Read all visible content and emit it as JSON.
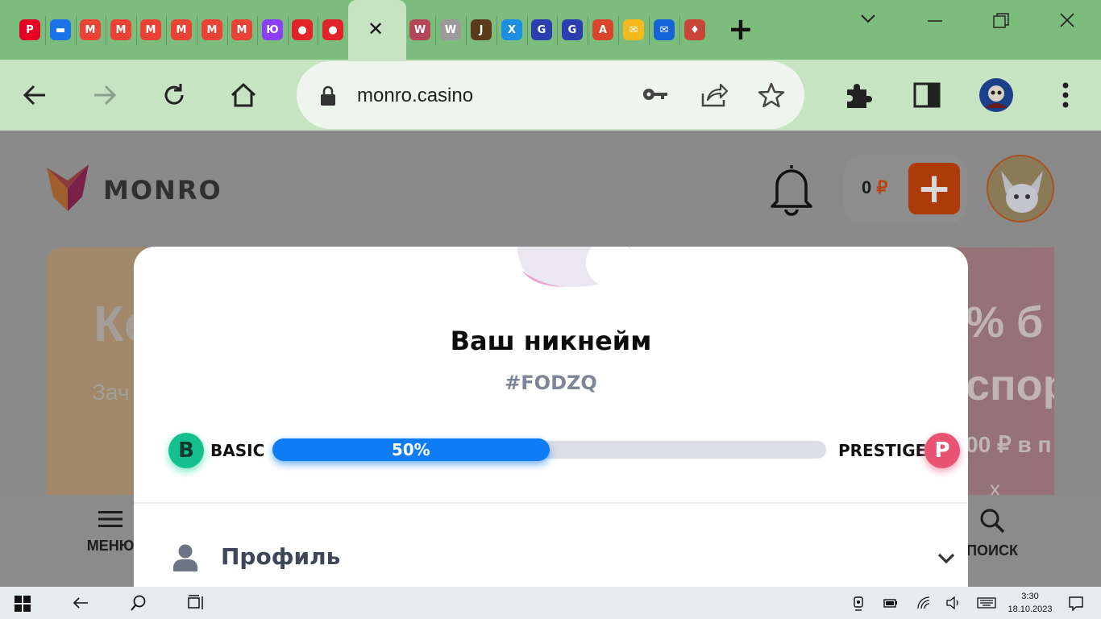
{
  "browser": {
    "tabs": [
      {
        "icon": "pinterest-red-icon",
        "color": "#e60023",
        "glyph": "P"
      },
      {
        "icon": "messages-icon",
        "color": "#1a73e8",
        "glyph": "▬"
      },
      {
        "icon": "gmail-icon",
        "color": "#ea4335",
        "glyph": "M"
      },
      {
        "icon": "gmail-icon",
        "color": "#ea4335",
        "glyph": "M"
      },
      {
        "icon": "gmail-icon",
        "color": "#ea4335",
        "glyph": "M"
      },
      {
        "icon": "gmail-icon",
        "color": "#ea4335",
        "glyph": "M"
      },
      {
        "icon": "gmail-icon",
        "color": "#ea4335",
        "glyph": "M"
      },
      {
        "icon": "gmail-icon",
        "color": "#ea4335",
        "glyph": "M"
      },
      {
        "icon": "yoomoney-icon",
        "color": "#8b3ffd",
        "glyph": "Ю"
      },
      {
        "icon": "casino-chip-icon",
        "color": "#e2232a",
        "glyph": "●"
      },
      {
        "icon": "casino-chip-icon",
        "color": "#e2232a",
        "glyph": "●"
      },
      {
        "icon": "w-logo-icon",
        "color": "#b5465a",
        "glyph": "W"
      },
      {
        "icon": "w-logo-icon",
        "color": "#9b9b9b",
        "glyph": "W"
      },
      {
        "icon": "joker-icon",
        "color": "#5b3a1a",
        "glyph": "J"
      },
      {
        "icon": "x-app-icon",
        "color": "#1d8fe1",
        "glyph": "X"
      },
      {
        "icon": "game-app-icon",
        "color": "#2b3eb0",
        "glyph": "G"
      },
      {
        "icon": "game-app-icon",
        "color": "#2b3eb0",
        "glyph": "G"
      },
      {
        "icon": "translate-icon",
        "color": "#d9442b",
        "glyph": "A"
      },
      {
        "icon": "mail-icon",
        "color": "#f6b91c",
        "glyph": "✉"
      },
      {
        "icon": "mail-icon",
        "color": "#1464d8",
        "glyph": "✉"
      },
      {
        "icon": "cards-icon",
        "color": "#c9453a",
        "glyph": "♦"
      }
    ],
    "active_tab_close": "✕",
    "new_tab": "+",
    "url": "monro.casino"
  },
  "site": {
    "logo_text": "MONRO",
    "balance_amount": "0",
    "balance_currency": "₽",
    "deposit_plus": "+",
    "colors": {
      "accent": "#ad3a08"
    }
  },
  "banner": {
    "left_title": "Ке",
    "left_sub": "Зач",
    "right_line1": "% б",
    "right_line2": "спор",
    "right_line3": "00 ₽ в п",
    "right_line4": "х ставок"
  },
  "bottom_nav": {
    "menu_label": "МЕНЮ",
    "search_label": "ПОИСК"
  },
  "modal": {
    "nickname": "Ваш никнейм",
    "tag": "#FODZQ",
    "level_current_letter": "B",
    "level_current": "BASIC",
    "progress_text": "50%",
    "progress": 0.5,
    "level_next": "PRESTIGE",
    "level_next_letter": "P",
    "colors": {
      "basic": "#16c08e",
      "prestige": "#ea5474",
      "progress": "#0d7cf5"
    },
    "profile_label": "Профиль"
  },
  "taskbar": {
    "time": "3:30",
    "date": "18.10.2023"
  }
}
